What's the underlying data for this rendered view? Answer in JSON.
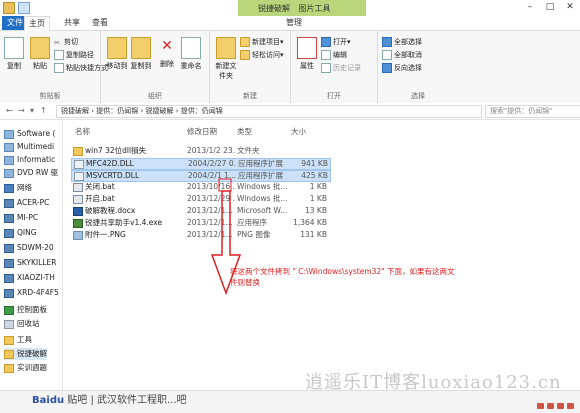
{
  "window": {
    "title": "锐捷破解",
    "context_tab": "图片工具",
    "quick_access": [
      "save",
      "properties"
    ],
    "controls": [
      "–",
      "□",
      "✕"
    ]
  },
  "ribbon_tabs": [
    {
      "label": "文件"
    },
    {
      "label": "主页"
    },
    {
      "label": "共享"
    },
    {
      "label": "查看"
    },
    {
      "label": "管理"
    }
  ],
  "ribbon": {
    "clipboard": {
      "label": "剪贴板",
      "copy": "复制",
      "paste": "粘贴",
      "cut": "剪切",
      "copy_path": "复制路径",
      "paste_shortcut": "粘贴快捷方式"
    },
    "organize": {
      "label": "组织",
      "move_to": "移动到",
      "copy_to": "复制到",
      "delete": "删除",
      "rename": "重命名"
    },
    "new": {
      "label": "新建",
      "new_folder": "新建文件夹",
      "new_item": "新建项目▾",
      "easy_access": "轻松访问▾"
    },
    "open": {
      "label": "打开",
      "properties": "属性",
      "open": "打开▾",
      "edit": "编辑",
      "history": "历史记录"
    },
    "select": {
      "label": "选择",
      "select_all": "全部选择",
      "select_none": "全部取消",
      "invert": "反向选择"
    }
  },
  "address": {
    "path": "锐捷破解 › 提供：仍闻锦 › 锐捷破解 › 提供：仍闻锦",
    "search_placeholder": "搜索\"提供：仍闻锦\""
  },
  "nav_items": [
    {
      "label": "Software (",
      "icon": "drive"
    },
    {
      "label": "Multimedi",
      "icon": "drive"
    },
    {
      "label": "Informatic",
      "icon": "drive"
    },
    {
      "label": "DVD RW 驱",
      "icon": "drive"
    },
    {
      "label": "网络",
      "icon": "net"
    },
    {
      "label": "ACER-PC",
      "icon": "pc"
    },
    {
      "label": "MI-PC",
      "icon": "pc"
    },
    {
      "label": "QING",
      "icon": "pc"
    },
    {
      "label": "SDWM-20",
      "icon": "pc"
    },
    {
      "label": "SKYKILLER",
      "icon": "pc"
    },
    {
      "label": "XIAOZI-TH",
      "icon": "pc"
    },
    {
      "label": "XRD-4F4F5",
      "icon": "pc"
    },
    {
      "label": "控制面板",
      "icon": "ctl"
    },
    {
      "label": "回收站",
      "icon": "bin"
    },
    {
      "label": "工具",
      "icon": "folder"
    },
    {
      "label": "锐捷破解",
      "icon": "folder"
    },
    {
      "label": "实训週題",
      "icon": "folder"
    }
  ],
  "columns": {
    "name": "名称",
    "date": "修改日期",
    "type": "类型",
    "size": "大小"
  },
  "files": [
    {
      "name": "win7 32位dll損失",
      "date": "2013/1/2 23...",
      "type": "文件夹",
      "size": "",
      "icon": "folder",
      "selected": false
    },
    {
      "name": "MFC42D.DLL",
      "date": "2004/2/27 0...",
      "type": "应用程序扩展",
      "size": "941 KB",
      "icon": "dll",
      "selected": true
    },
    {
      "name": "MSVCRTD.DLL",
      "date": "2004/2/1 1...",
      "type": "应用程序扩展",
      "size": "425 KB",
      "icon": "dll",
      "selected": true
    },
    {
      "name": "关闭.bat",
      "date": "2013/10/16 ...",
      "type": "Windows 批...",
      "size": "1 KB",
      "icon": "bat",
      "selected": false
    },
    {
      "name": "开启.bat",
      "date": "2013/12/29 ...",
      "type": "Windows 批...",
      "size": "1 KB",
      "icon": "bat",
      "selected": false
    },
    {
      "name": "破解教程.docx",
      "date": "2013/12/1...",
      "type": "Microsoft W...",
      "size": "13 KB",
      "icon": "doc",
      "selected": false
    },
    {
      "name": "锐捷共享助手v1.4.exe",
      "date": "2013/12/1...",
      "type": "应用程序",
      "size": "1,364 KB",
      "icon": "exe",
      "selected": false
    },
    {
      "name": "附件一.PNG",
      "date": "2013/12/1...",
      "type": "PNG 图像",
      "size": "131 KB",
      "icon": "png",
      "selected": false
    }
  ],
  "annotation": "将这两个文件拷到 \" C:\\Windows\\system32\" 下面，如果有这两文件则替换",
  "watermark_left": {
    "brand": "Bai",
    "brand2": "du",
    "text": "贴吧 | 武汉软件工程职...吧"
  },
  "watermark_right": "逍遥乐IT博客luoxiao123.cn",
  "accent": "#1f6fc7",
  "selection_color": "#cce1f7"
}
